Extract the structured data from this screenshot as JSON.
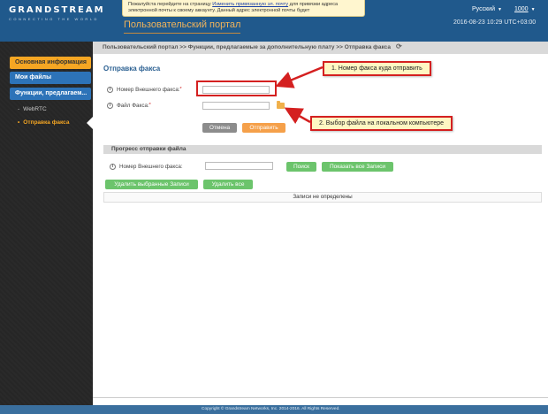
{
  "header": {
    "logo_main": "GRANDSTREAM",
    "logo_sub": "CONNECTING THE WORLD",
    "notice_prefix": "Пожалуйста перейдите на страницу ",
    "notice_link": "Изменить привязанную эл. почту",
    "notice_suffix": " для привязки адреса электронной почты к своему аккаунту. Данный адрес электронной почты будет",
    "language": "Русский",
    "user": "1000",
    "datetime": "2016-08-23 10:29 UTC+03:00",
    "portal_title": "Пользовательский портал"
  },
  "sidebar": {
    "items": [
      {
        "label": "Основная информация"
      },
      {
        "label": "Мои файлы"
      },
      {
        "label": "Функции, предлагаем..."
      }
    ],
    "subitems": [
      {
        "label": "WebRTC"
      },
      {
        "label": "Отправка факса"
      }
    ]
  },
  "breadcrumb": {
    "text": "Пользовательский портал >> Функции, предлагаемые за дополнительную плату >> Отправка факса"
  },
  "fax_form": {
    "title": "Отправка факса",
    "external_fax_label": "Номер Внешнего факса:",
    "external_fax_value": "",
    "fax_file_label": "Файл Факса:",
    "fax_file_value": "",
    "cancel_label": "Отмена",
    "send_label": "Отправить"
  },
  "callouts": {
    "first": "1. Номер факса куда отправить",
    "second": "2. Выбор файла на локальном компьютере"
  },
  "progress": {
    "title": "Прогресс отправки файла",
    "external_fax_label": "Номер Внешнего факса:",
    "external_fax_value": "",
    "search_label": "Поиск",
    "show_all_label": "Показать все Записи",
    "delete_selected_label": "Удалить выбранные Записи",
    "delete_all_label": "Удалить все",
    "no_records": "Записи не определены"
  },
  "footer": {
    "copyright": "Copyright © Grandstream Networks, Inc. 2014-2016. All Rights Reserved."
  },
  "colors": {
    "header_blue": "#20598c",
    "accent_orange": "#f5a623",
    "callout_red": "#d42020",
    "button_green": "#6cc46c"
  }
}
